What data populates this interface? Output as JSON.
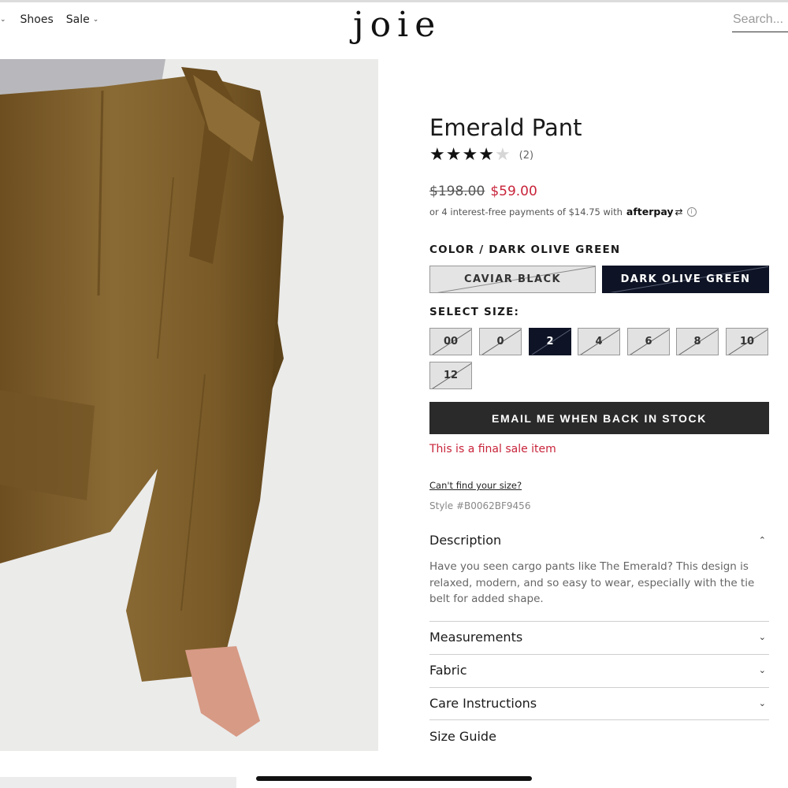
{
  "header": {
    "nav_items": [
      {
        "label": "Shoes"
      },
      {
        "label": "Sale"
      }
    ],
    "logo": "joie",
    "search_placeholder": "Search..."
  },
  "product": {
    "title": "Emerald Pant",
    "rating": {
      "value": 4,
      "max": 5,
      "count_label": "(2)"
    },
    "price_original": "$198.00",
    "price_sale": "$59.00",
    "afterpay_text": "or 4 interest-free payments of $14.75 with",
    "afterpay_brand": "afterpay",
    "color_label": "COLOR / DARK OLIVE GREEN",
    "colors": [
      {
        "label": "CAVIAR BLACK",
        "selected": false
      },
      {
        "label": "DARK OLIVE GREEN",
        "selected": true
      }
    ],
    "size_label": "SELECT SIZE:",
    "sizes": [
      {
        "label": "00",
        "selected": false
      },
      {
        "label": "0",
        "selected": false
      },
      {
        "label": "2",
        "selected": true
      },
      {
        "label": "4",
        "selected": false
      },
      {
        "label": "6",
        "selected": false
      },
      {
        "label": "8",
        "selected": false
      },
      {
        "label": "10",
        "selected": false
      },
      {
        "label": "12",
        "selected": false
      }
    ],
    "notify_button": "EMAIL ME WHEN BACK IN STOCK",
    "final_sale": "This is a final sale item",
    "cant_find_size": "Can't find your size?",
    "style_number": "Style #B0062BF9456",
    "accordion": {
      "description": {
        "label": "Description",
        "text": "Have you seen cargo pants like The Emerald? This design is relaxed, modern, and so easy to wear, especially with the tie belt for added shape.",
        "expanded": true
      },
      "measurements": {
        "label": "Measurements",
        "expanded": false
      },
      "fabric": {
        "label": "Fabric",
        "expanded": false
      },
      "care": {
        "label": "Care Instructions",
        "expanded": false
      },
      "size_guide": {
        "label": "Size Guide"
      }
    }
  },
  "colors": {
    "sale_red": "#c8243a",
    "selected_navy": "#0e1425",
    "button_dark": "#2a2a2a",
    "olive_fabric": "#7a5a2a"
  },
  "icons": {
    "nav_chevron": "chevron-down-icon",
    "star": "star-icon",
    "info": "info-icon",
    "accordion_up": "chevron-up-icon",
    "accordion_down": "chevron-down-icon"
  }
}
